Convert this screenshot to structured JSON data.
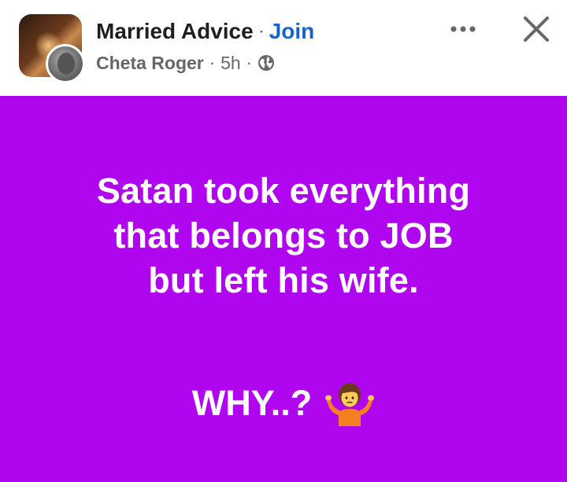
{
  "header": {
    "group_name": "Married Advice",
    "separator": "·",
    "join_label": "Join",
    "author": "Cheta Roger",
    "time": "5h",
    "privacy_icon": "globe-icon",
    "more_icon": "more-horizontal-icon",
    "close_icon": "close-icon"
  },
  "post": {
    "background_color": "#b006ef",
    "lines": [
      "Satan took everything",
      "that belongs to JOB",
      "but left his wife."
    ],
    "question": "WHY..?",
    "emoji_icon": "person-shrugging-icon"
  }
}
